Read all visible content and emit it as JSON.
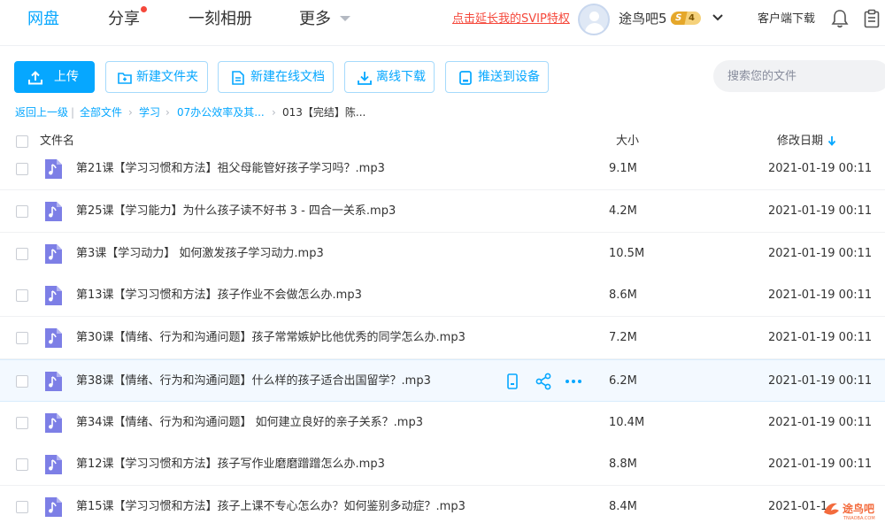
{
  "nav": {
    "tabs": [
      {
        "label": "网盘",
        "active": true
      },
      {
        "label": "分享",
        "has_dot": true
      },
      {
        "label": "一刻相册"
      },
      {
        "label": "更多"
      }
    ],
    "svip_link": "点击延长我的SVIP特权",
    "username": "途鸟吧5",
    "level": "4",
    "level_prefix": "S",
    "client_download": "客户端下载"
  },
  "toolbar": {
    "upload": "上传",
    "new_folder": "新建文件夹",
    "new_doc": "新建在线文档",
    "offline_download": "离线下载",
    "push_device": "推送到设备",
    "search_placeholder": "搜索您的文件"
  },
  "breadcrumb": {
    "back": "返回上一级",
    "all_files": "全部文件",
    "level1": "学习",
    "level2": "07办公效率及其...",
    "current": "013【完结】陈..."
  },
  "table": {
    "headers": {
      "name": "文件名",
      "size": "大小",
      "date": "修改日期"
    },
    "rows": [
      {
        "name": "第21课【学习习惯和方法】祖父母能管好孩子学习吗？.mp3",
        "size": "9.1M",
        "date": "2021-01-19 00:11"
      },
      {
        "name": "第25课【学习能力】为什么孩子读不好书 3 - 四合一关系.mp3",
        "size": "4.2M",
        "date": "2021-01-19 00:11"
      },
      {
        "name": "第3课【学习动力】 如何激发孩子学习动力.mp3",
        "size": "10.5M",
        "date": "2021-01-19 00:11"
      },
      {
        "name": "第13课【学习习惯和方法】孩子作业不会做怎么办.mp3",
        "size": "8.6M",
        "date": "2021-01-19 00:11"
      },
      {
        "name": "第30课【情绪、行为和沟通问题】孩子常常嫉妒比他优秀的同学怎么办.mp3",
        "size": "7.2M",
        "date": "2021-01-19 00:11"
      },
      {
        "name": "第38课【情绪、行为和沟通问题】什么样的孩子适合出国留学？.mp3",
        "size": "6.2M",
        "date": "2021-01-19 00:11",
        "hover": true
      },
      {
        "name": "第34课【情绪、行为和沟通问题】 如何建立良好的亲子关系？.mp3",
        "size": "10.4M",
        "date": "2021-01-19 00:11"
      },
      {
        "name": "第12课【学习习惯和方法】孩子写作业磨磨蹭蹭怎么办.mp3",
        "size": "8.8M",
        "date": "2021-01-19 00:11"
      },
      {
        "name": "第15课【学习习惯和方法】孩子上课不专心怎么办？如何鉴别多动症？.mp3",
        "size": "8.4M",
        "date": "2021-01-1"
      }
    ]
  },
  "watermark": {
    "text": "途鸟吧",
    "sub": "TNIAOBA.COM"
  },
  "colors": {
    "accent": "#06a7ff",
    "danger": "#f5483b",
    "file_icon": "#7d7fe6"
  }
}
